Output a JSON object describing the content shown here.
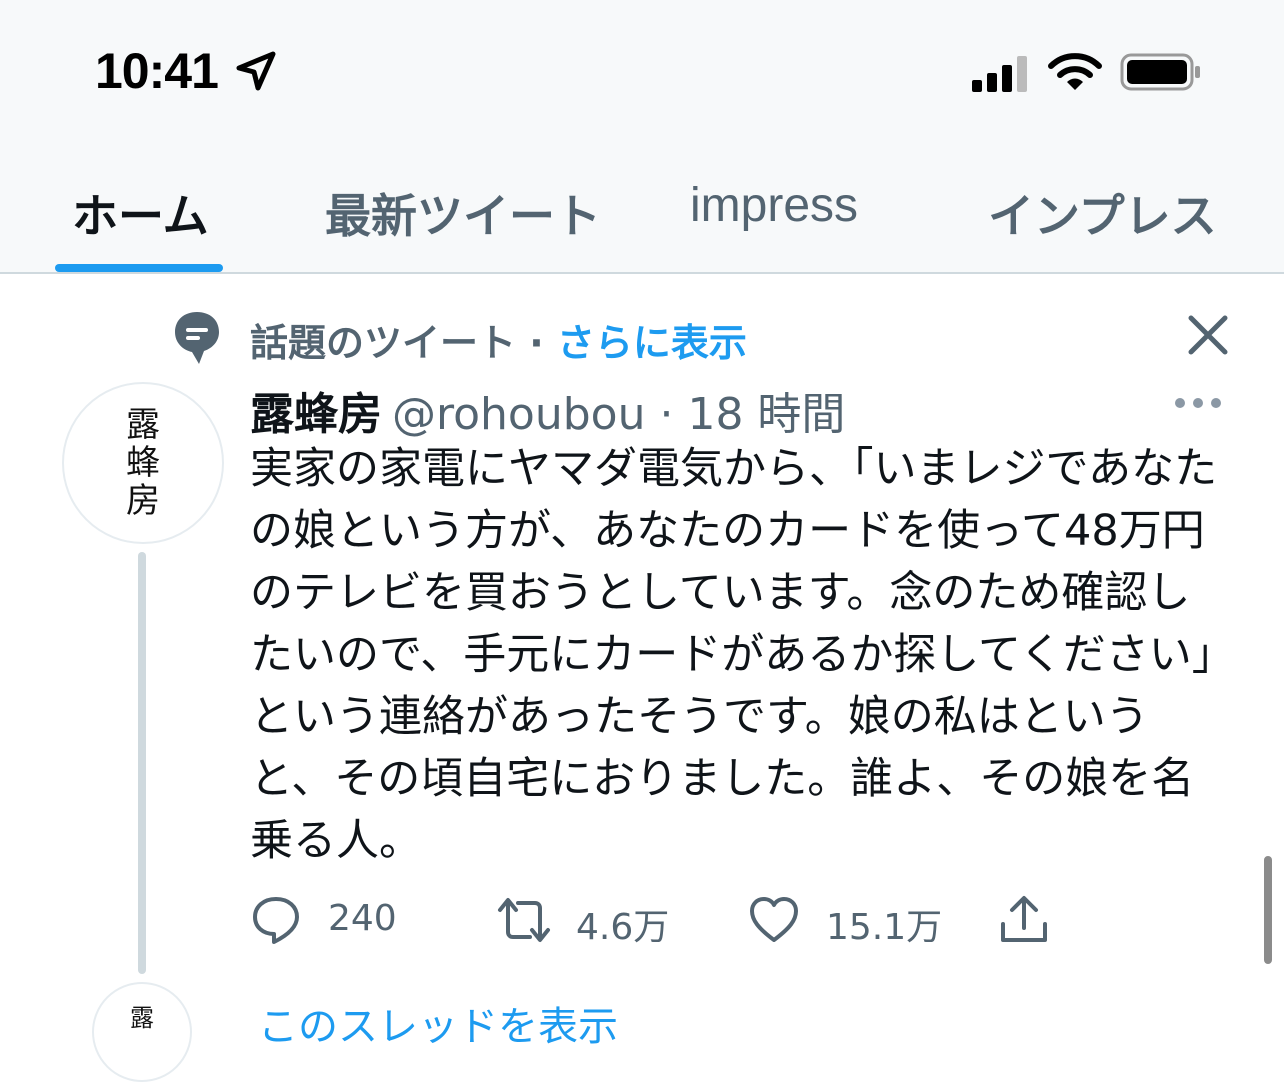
{
  "status_bar": {
    "time": "10:41"
  },
  "tabs": [
    {
      "label": "ホーム",
      "active": true
    },
    {
      "label": "最新ツイート",
      "active": false
    },
    {
      "label": "impress",
      "active": false
    },
    {
      "label": "インプレス",
      "active": false
    }
  ],
  "colors": {
    "accent": "#1d9bf0",
    "muted": "#536471",
    "text": "#0f1419"
  },
  "tweet": {
    "context_label": "話題のツイート · ",
    "context_link": "さらに表示",
    "avatar_text": "露\n蜂\n房",
    "display_name": "露蜂房",
    "handle": "@rohoubou",
    "time": " · 18 時間",
    "text": "実家の家電にヤマダ電気から、「いまレジであなたの娘という方が、あなたのカードを使って48万円のテレビを買おうとしています。念のため確認したいので、手元にカードがあるか探してください」という連絡があったそうです。娘の私はというと、その頃自宅におりました。誰よ、その娘を名乗る人。",
    "replies": "240",
    "retweets": "4.6万",
    "likes": "15.1万"
  },
  "next": {
    "avatar_text": "露",
    "show_thread": "このスレッドを表示"
  }
}
